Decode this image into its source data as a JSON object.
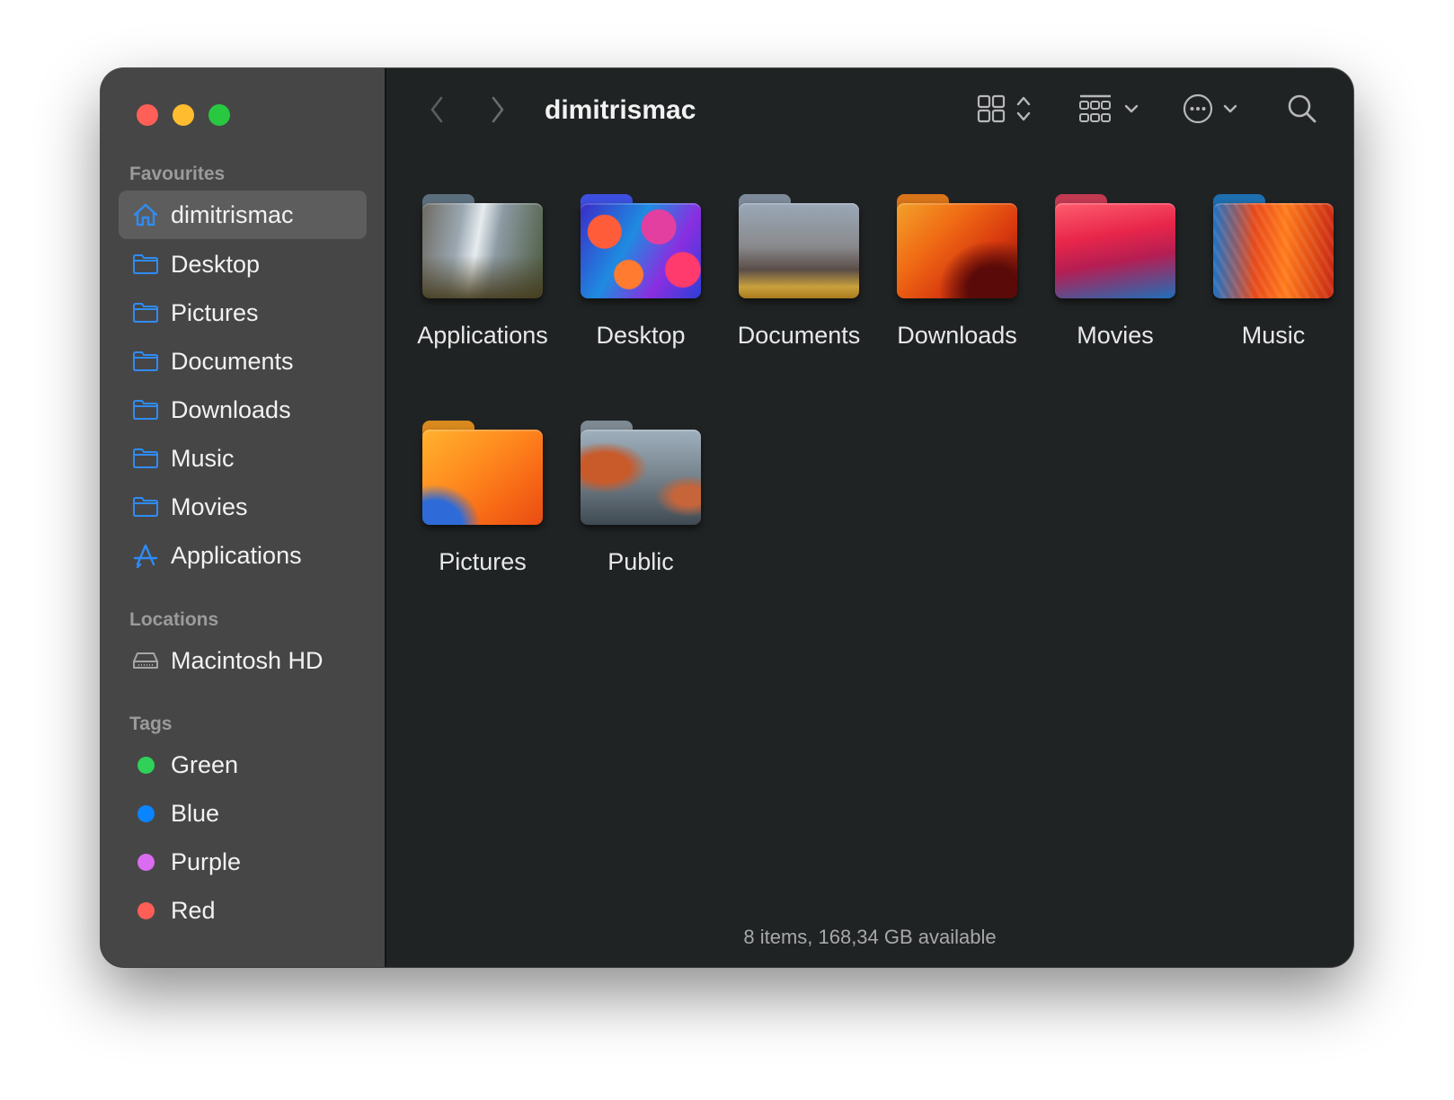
{
  "window": {
    "title": "dimitrismac"
  },
  "sidebar": {
    "favourites_title": "Favourites",
    "favourites": [
      {
        "label": "dimitrismac",
        "icon": "home-icon",
        "selected": true
      },
      {
        "label": "Desktop",
        "icon": "folder-icon"
      },
      {
        "label": "Pictures",
        "icon": "folder-icon"
      },
      {
        "label": "Documents",
        "icon": "folder-icon"
      },
      {
        "label": "Downloads",
        "icon": "folder-icon"
      },
      {
        "label": "Music",
        "icon": "folder-icon"
      },
      {
        "label": "Movies",
        "icon": "folder-icon"
      },
      {
        "label": "Applications",
        "icon": "applications-icon"
      }
    ],
    "locations_title": "Locations",
    "locations": [
      {
        "label": "Macintosh HD",
        "icon": "hard-drive-icon"
      }
    ],
    "tags_title": "Tags",
    "tags": [
      {
        "label": "Green",
        "color": "#30d158"
      },
      {
        "label": "Blue",
        "color": "#0a84ff"
      },
      {
        "label": "Purple",
        "color": "#bf5af2"
      },
      {
        "label": "Red",
        "color": "#ff453a"
      }
    ]
  },
  "toolbar": {
    "back_icon": "chevron-left-icon",
    "forward_icon": "chevron-right-icon",
    "view_icon": "icon-grid-icon",
    "group_icon": "group-icon",
    "more_icon": "ellipsis-circle-icon",
    "search_icon": "search-icon"
  },
  "files": [
    {
      "name": "Applications",
      "theme": "yosemite"
    },
    {
      "name": "Desktop",
      "theme": "abstract"
    },
    {
      "name": "Documents",
      "theme": "high-sierra"
    },
    {
      "name": "Downloads",
      "theme": "ventura"
    },
    {
      "name": "Movies",
      "theme": "big-sur"
    },
    {
      "name": "Music",
      "theme": "monterey"
    },
    {
      "name": "Pictures",
      "theme": "ventura-light"
    },
    {
      "name": "Public",
      "theme": "el-capitan"
    }
  ],
  "status": {
    "text": "8 items, 168,34 GB available",
    "zoom_level": 0.3
  },
  "colors": {
    "accent": "#0a84ff"
  }
}
